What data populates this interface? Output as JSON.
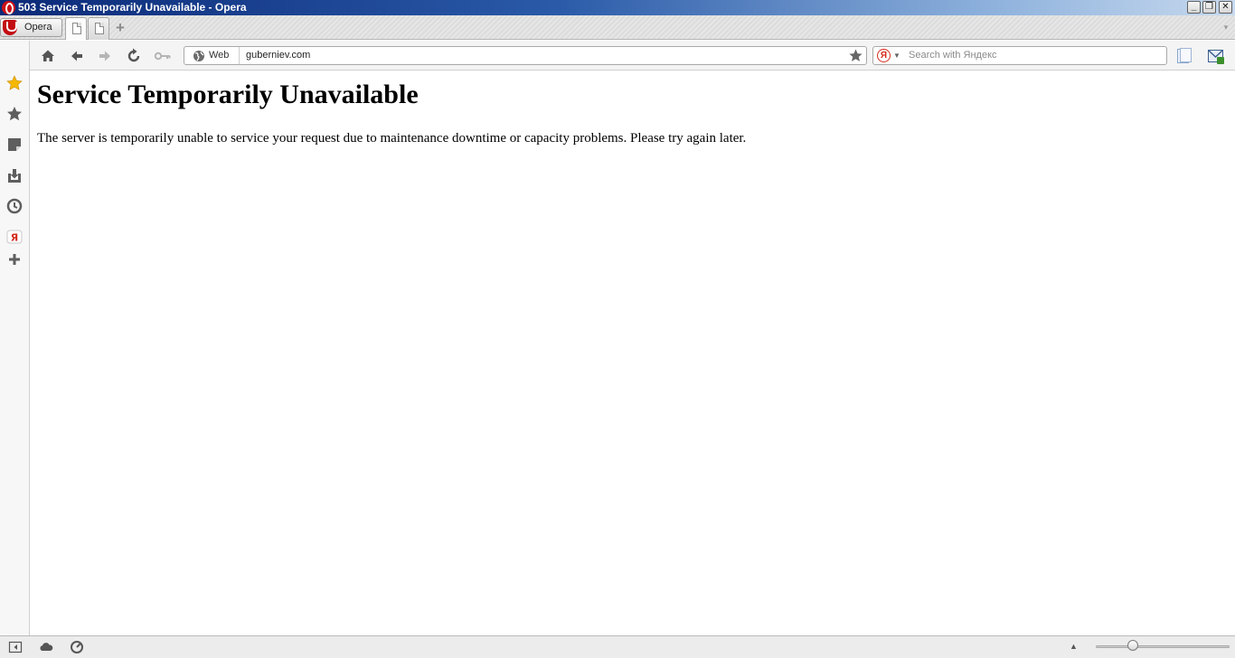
{
  "window": {
    "title": "503 Service Temporarily Unavailable - Opera"
  },
  "opera_menu": {
    "label": "Opera"
  },
  "tabs": [
    {
      "active": true
    },
    {
      "active": false
    }
  ],
  "toolbar": {
    "address": {
      "scheme_label": "Web",
      "url": "guberniev.com"
    },
    "search": {
      "engine": "Yandex",
      "engine_glyph": "Я",
      "placeholder": "Search with Яндекс"
    }
  },
  "sidebar": {
    "items": [
      {
        "icon": "speed-dial-icon"
      },
      {
        "icon": "bookmarks-icon"
      },
      {
        "icon": "notes-icon"
      },
      {
        "icon": "downloads-icon"
      },
      {
        "icon": "history-icon"
      },
      {
        "icon": "yandex-panel-icon"
      },
      {
        "icon": "add-panel-icon"
      }
    ]
  },
  "page": {
    "heading": "Service Temporarily Unavailable",
    "message": "The server is temporarily unable to service your request due to maintenance downtime or capacity problems. Please try again later."
  },
  "statusbar": {
    "zoom_fraction": 0.28
  },
  "colors": {
    "title_bar_start": "#0b2a78",
    "opera_red": "#cc0f16",
    "speed_dial_star": "#f5b800",
    "yandex_red": "#d42a1c"
  }
}
